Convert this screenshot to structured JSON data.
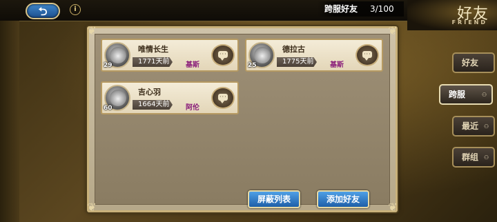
{
  "header": {
    "back_icon": "back-arrow-icon",
    "back_glyph": "⮌",
    "info_glyph": "i",
    "counter_label": "跨服好友",
    "counter_value": "3/100",
    "title": "好友",
    "title_en": "FRIEND"
  },
  "friends": [
    {
      "name": "唯情长生",
      "level": "29",
      "time": "1771天前",
      "server": "基斯"
    },
    {
      "name": "德拉古",
      "level": "25",
      "time": "1775天前",
      "server": "基斯"
    },
    {
      "name": "吉心羽",
      "level": "60",
      "time": "1664天前",
      "server": "阿伦"
    }
  ],
  "buttons": {
    "block_list": "屏蔽列表",
    "add_friend": "添加好友"
  },
  "tabs": [
    {
      "label": "好友",
      "active": false
    },
    {
      "label": "跨服",
      "active": true
    },
    {
      "label": "最近",
      "active": false
    },
    {
      "label": "群组",
      "active": false
    }
  ],
  "colors": {
    "server_text": "#8a1e7a",
    "button_blue": "#1e5fa8"
  }
}
